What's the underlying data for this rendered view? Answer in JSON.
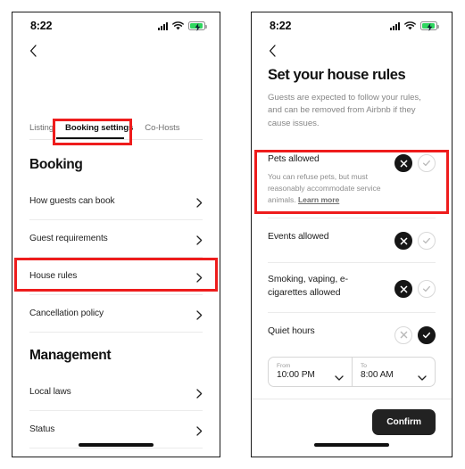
{
  "screen_left": {
    "status_bar": {
      "time": "8:22",
      "cellular_icon": "cellular-signal-icon",
      "wifi_icon": "wifi-icon",
      "battery_icon": "battery-charging-icon",
      "battery_color": "#2fd65f"
    },
    "back_icon": "chevron-left-icon",
    "tabs": [
      {
        "label": "Listing",
        "active": false
      },
      {
        "label": "Booking settings",
        "active": true
      },
      {
        "label": "Co-Hosts",
        "active": false
      }
    ],
    "sections": [
      {
        "title": "Booking",
        "rows": [
          {
            "label": "How guests can book"
          },
          {
            "label": "Guest requirements"
          },
          {
            "label": "House rules"
          },
          {
            "label": "Cancellation policy"
          }
        ]
      },
      {
        "title": "Management",
        "rows": [
          {
            "label": "Local laws"
          },
          {
            "label": "Status"
          }
        ]
      }
    ]
  },
  "screen_right": {
    "status_bar": {
      "time": "8:22",
      "cellular_icon": "cellular-signal-icon",
      "wifi_icon": "wifi-icon",
      "battery_icon": "battery-charging-icon",
      "battery_color": "#2fd65f"
    },
    "back_icon": "chevron-left-icon",
    "title": "Set your house rules",
    "subtitle": "Guests are expected to follow your rules, and can be removed from Airbnb if they cause issues.",
    "rules": [
      {
        "title": "Pets allowed",
        "description": "You can refuse pets, but must reasonably accommodate service ",
        "description_link": "Learn more",
        "description_prefix2": "animals. ",
        "selected": "no"
      },
      {
        "title": "Events allowed",
        "description": "",
        "selected": "no"
      },
      {
        "title": "Smoking, vaping, e-cigarettes allowed",
        "description": "",
        "selected": "no"
      },
      {
        "title": "Quiet hours",
        "description": "",
        "selected": "yes"
      }
    ],
    "quiet_hours": {
      "from_label": "From",
      "from_value": "10:00 PM",
      "to_label": "To",
      "to_value": "8:00 AM",
      "dropdown_icon": "chevron-down-icon"
    },
    "confirm_label": "Confirm"
  },
  "annotations": {
    "accent_color": "#ee1c1c",
    "boxes": [
      {
        "name": "booking-settings-tab-highlight"
      },
      {
        "name": "house-rules-row-highlight"
      },
      {
        "name": "pets-allowed-rule-highlight"
      }
    ]
  }
}
